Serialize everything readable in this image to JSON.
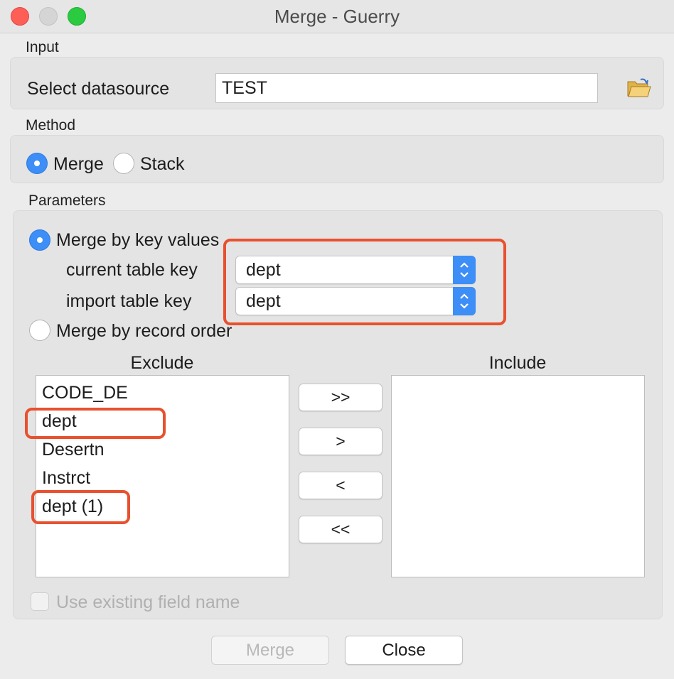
{
  "window": {
    "title": "Merge - Guerry"
  },
  "input": {
    "section_label": "Input",
    "datasource_label": "Select datasource",
    "datasource_value": "TEST",
    "open_icon": "folder-open-icon"
  },
  "method": {
    "section_label": "Method",
    "options": [
      {
        "label": "Merge",
        "selected": true
      },
      {
        "label": "Stack",
        "selected": false
      }
    ]
  },
  "parameters": {
    "section_label": "Parameters",
    "merge_by_key_label": "Merge by key values",
    "merge_by_key_selected": true,
    "current_key_label": "current table key",
    "current_key_value": "dept",
    "import_key_label": "import table key",
    "import_key_value": "dept",
    "merge_by_order_label": "Merge by record order",
    "merge_by_order_selected": false
  },
  "fields": {
    "exclude_header": "Exclude",
    "include_header": "Include",
    "exclude_items": [
      "CODE_DE",
      "dept",
      "Desertn",
      "Instrct",
      "dept (1)"
    ],
    "include_items": [],
    "move_buttons": [
      ">>",
      ">",
      "<",
      "<<"
    ]
  },
  "use_existing": {
    "label": "Use existing field name",
    "checked": false,
    "enabled": false
  },
  "footer": {
    "merge_label": "Merge",
    "close_label": "Close"
  },
  "annotations": {
    "highlight_color": "#e8512f"
  }
}
